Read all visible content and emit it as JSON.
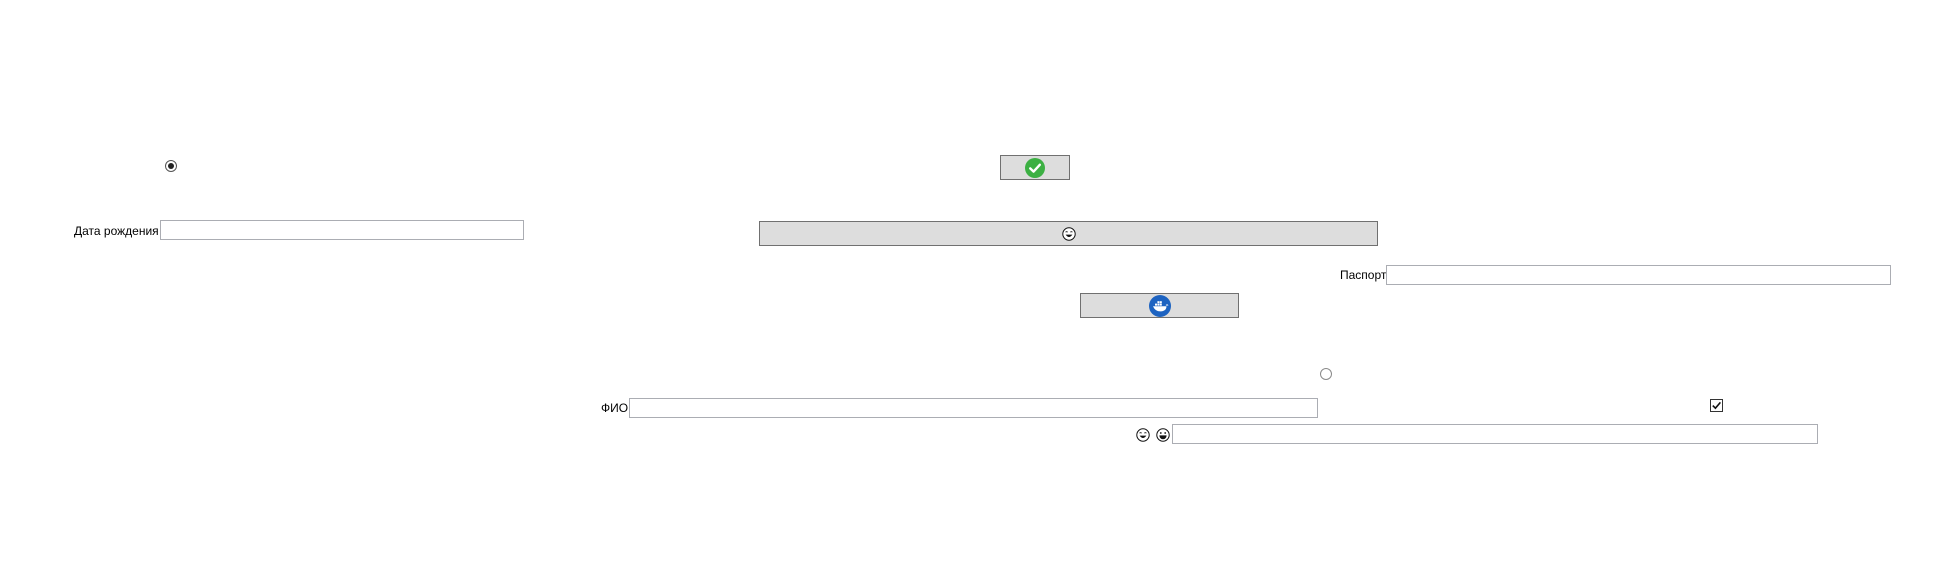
{
  "form": {
    "birth_date": {
      "label": "Дата рождения",
      "value": "",
      "placeholder": ""
    },
    "passport": {
      "label": "Паспорт",
      "value": "",
      "placeholder": ""
    },
    "full_name": {
      "label": "ФИО",
      "value": "",
      "placeholder": ""
    },
    "extra_field": {
      "value": "",
      "placeholder": ""
    },
    "radio_top": {
      "checked": true
    },
    "radio_middle": {
      "checked": false
    },
    "checkbox": {
      "checked": true
    }
  },
  "buttons": {
    "confirm": {
      "icon": "green-check-icon",
      "color": "#3cb043"
    },
    "wide": {
      "icon": "laughing-face-icon"
    },
    "docker": {
      "icon": "docker-whale-icon",
      "color": "#1d63c1"
    }
  },
  "icons": {
    "left_emoji": "laughing-face-icon",
    "right_emoji": "grinning-face-icon"
  },
  "colors": {
    "button_bg": "#dddddd",
    "button_border": "#707070",
    "textbox_border": "#abadb3"
  }
}
